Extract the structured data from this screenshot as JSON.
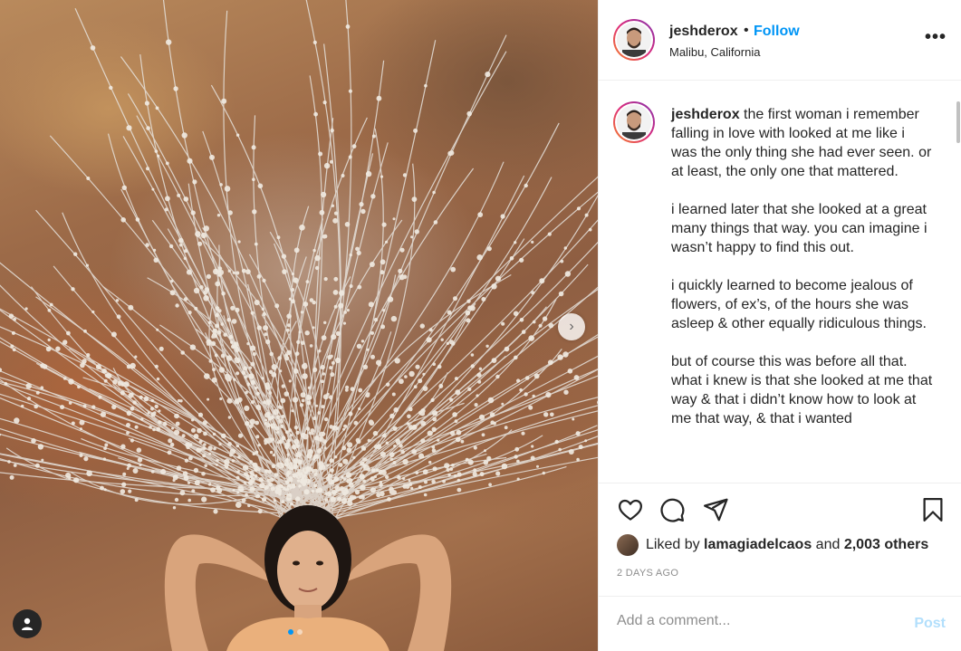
{
  "post": {
    "author": {
      "username": "jeshderox",
      "location": "Malibu, California",
      "follow_label": "Follow",
      "separator": "•"
    },
    "more_label": "•••",
    "caption": {
      "username": "jeshderox",
      "paragraphs": [
        "the first woman i remember falling in love with looked at me like i was the only thing she had ever seen. or at least, the only one that mattered.",
        "i learned later that she looked at a great many things that way. you can imagine i wasn’t happy to find this out.",
        "i quickly learned to become jealous of flowers, of ex’s, of the hours she was asleep & other equally ridiculous things.",
        "but of course this was before all that. what i knew is that she looked at me that way & that i didn’t know how to look at me that way, & that i wanted"
      ]
    },
    "likes": {
      "prefix": "Liked by",
      "liker": "lamagiadelcaos",
      "conjunction": "and",
      "others": "2,003 others"
    },
    "timestamp": "2 DAYS AGO",
    "comment": {
      "placeholder": "Add a comment...",
      "post_label": "Post"
    },
    "carousel": {
      "total": 2,
      "active_index": 0,
      "next_glyph": "›"
    }
  },
  "icons": {
    "like": "heart-icon",
    "comment": "comment-bubble-icon",
    "share": "paper-plane-icon",
    "save": "bookmark-icon",
    "tag": "user-tag-icon",
    "next": "chevron-right-icon"
  },
  "colors": {
    "accent": "#0095f6",
    "post_disabled": "#b2dffc",
    "muted": "#8e8e8e",
    "text": "#262626",
    "avatar_ring_start": "#f58529",
    "avatar_ring_end": "#8134af"
  }
}
